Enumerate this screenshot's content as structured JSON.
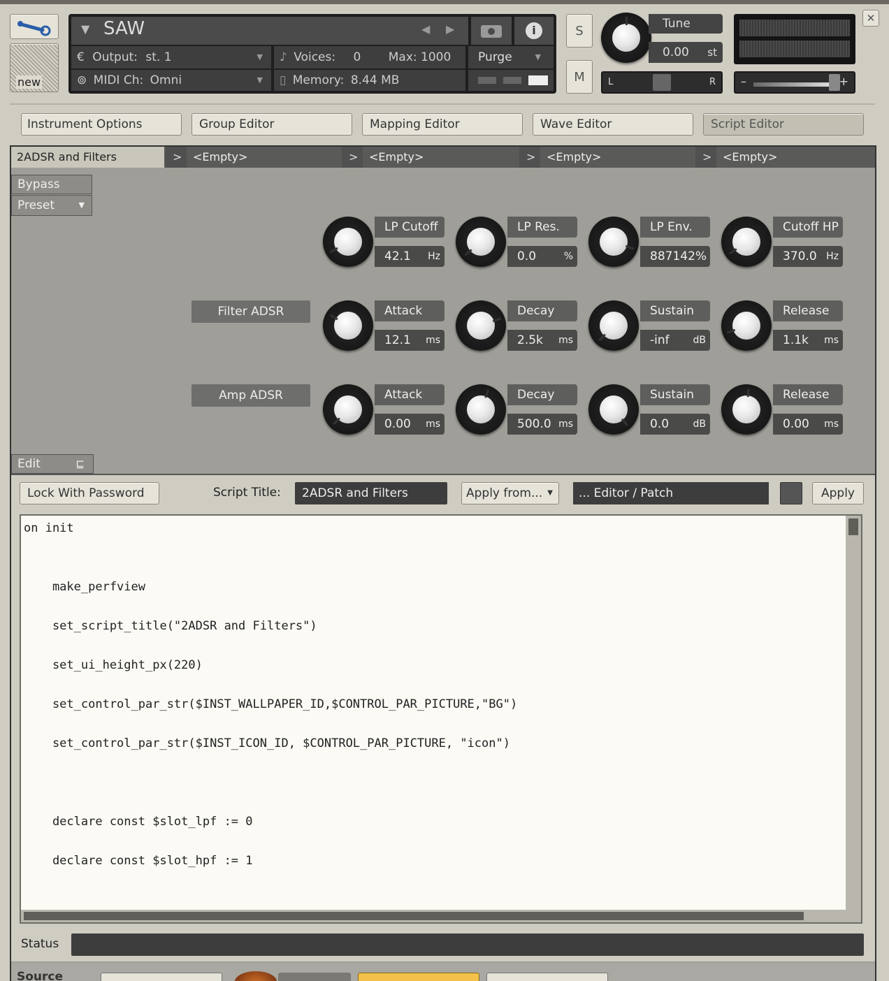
{
  "header": {
    "instrument_name": "SAW",
    "output_label": "Output:",
    "output_value": "st. 1",
    "voices_label": "Voices:",
    "voices_value": "0",
    "max_label": "Max:",
    "max_value": "1000",
    "purge_label": "Purge",
    "midi_label": "MIDI Ch:",
    "midi_value": "Omni",
    "memory_label": "Memory:",
    "memory_value": "8.44 MB",
    "new_label": "new",
    "solo_label": "S",
    "mute_label": "M",
    "tune_label": "Tune",
    "tune_value": "0.00",
    "tune_unit": "st",
    "pan_left": "L",
    "pan_right": "R",
    "vol_minus": "–",
    "vol_plus": "+",
    "close_label": "✕"
  },
  "editor_tabs": [
    "Instrument Options",
    "Group Editor",
    "Mapping Editor",
    "Wave Editor",
    "Script Editor"
  ],
  "slot_tabs": [
    "2ADSR and Filters",
    "<Empty>",
    "<Empty>",
    "<Empty>",
    "<Empty>"
  ],
  "slot_arrow": ">",
  "bypass_label": "Bypass",
  "preset_label": "Preset",
  "rows": [
    {
      "section": "",
      "controls": [
        {
          "label": "LP Cutoff",
          "value": "42.1",
          "unit": "Hz",
          "angle": -120
        },
        {
          "label": "LP Res.",
          "value": "0.0",
          "unit": "%",
          "angle": -130
        },
        {
          "label": "LP Env.",
          "value": "887142%",
          "unit": "",
          "angle": 110
        },
        {
          "label": "Cutoff HP",
          "value": "370.0",
          "unit": "Hz",
          "angle": -125
        }
      ]
    },
    {
      "section": "Filter ADSR",
      "controls": [
        {
          "label": "Attack",
          "value": "12.1",
          "unit": "ms",
          "angle": -60
        },
        {
          "label": "Decay",
          "value": "2.5k",
          "unit": "ms",
          "angle": 70
        },
        {
          "label": "Sustain",
          "value": "-inf",
          "unit": "dB",
          "angle": -135
        },
        {
          "label": "Release",
          "value": "1.1k",
          "unit": "ms",
          "angle": -110
        }
      ]
    },
    {
      "section": "Amp ADSR",
      "controls": [
        {
          "label": "Attack",
          "value": "0.00",
          "unit": "ms",
          "angle": -135
        },
        {
          "label": "Decay",
          "value": "500.0",
          "unit": "ms",
          "angle": 20
        },
        {
          "label": "Sustain",
          "value": "0.0",
          "unit": "dB",
          "angle": 140
        },
        {
          "label": "Release",
          "value": "0.00",
          "unit": "ms",
          "angle": 5
        }
      ]
    }
  ],
  "edit_label": "Edit",
  "lock_label": "Lock With Password",
  "script_title_label": "Script Title:",
  "script_title_value": "2ADSR and Filters",
  "apply_from_label": "Apply from...",
  "patch_label": "... Editor / Patch",
  "apply_label": "Apply",
  "code_lines": [
    "on init",
    "",
    "",
    "    make_perfview",
    "",
    "    set_script_title(\"2ADSR and Filters\")",
    "",
    "    set_ui_height_px(220)",
    "",
    "    set_control_par_str($INST_WALLPAPER_ID,$CONTROL_PAR_PICTURE,\"BG\")",
    "",
    "    set_control_par_str($INST_ICON_ID, $CONTROL_PAR_PICTURE, \"icon\")",
    "",
    "",
    "",
    "    declare const $slot_lpf := 0",
    "",
    "    declare const $slot_hpf := 1"
  ],
  "status_label": "Status",
  "source_label": "Source"
}
